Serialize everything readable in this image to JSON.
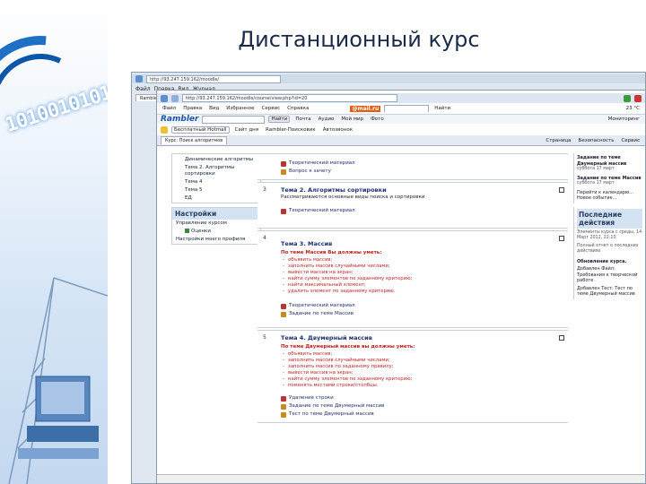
{
  "slide": {
    "title": "Дистанционный курс"
  },
  "decor": {
    "binary_text": "10100101010"
  },
  "back_window": {
    "address": "http://93.247.159.162/moodle/",
    "menu_items": [
      "Файл",
      "Правка",
      "Вид",
      "Журнал"
    ],
    "tab_labels": [
      "Rambler"
    ]
  },
  "browser": {
    "address": "http://93.247.159.162/moodle/course/view.php?id=20",
    "menu_items": [
      "Файл",
      "Правка",
      "Вид",
      "Избранное",
      "Сервис",
      "Справка"
    ],
    "toolbar": {
      "favorites": "Избранное",
      "rambler": "Rambler",
      "mail": "@mail.ru",
      "search_btn": "Найти",
      "search_btn2": "Найти",
      "items": [
        "Почта",
        "Аудио",
        "Мой мир",
        "Фото"
      ],
      "temp": "23 °C",
      "monitor": "Мониторинг"
    },
    "links_bar": [
      "Бесплатный Hotmail",
      "Сайт дня",
      "Rambler-Поисковик",
      "Автозвонок"
    ],
    "tab_label": "Курс: Поиск алгоритмов",
    "right_tools": [
      "Страница",
      "Безопасность",
      "Сервис"
    ]
  },
  "left_blocks": {
    "tree": [
      "Динамические алгоритмы",
      "Тема 2. Алгоритмы сортировки",
      "Тема 4",
      "Тема 5",
      "ЕД"
    ],
    "settings": {
      "title": "Настройки",
      "items": [
        "Управление курсом",
        "Оценки",
        "Настройки моего профиля"
      ]
    },
    "cut_letters": [
      "Н"
    ]
  },
  "topics": [
    {
      "num": "",
      "title": "",
      "subtitle": "",
      "must": "",
      "bullets": [],
      "resources": [
        "Теоретический материал",
        "Вопрос к зачету"
      ]
    },
    {
      "num": "3",
      "title": "Тема 2. Алгоритмы сортировки",
      "subtitle": "Рассматриваются основные виды поиска и сортировки",
      "must": "",
      "bullets": [],
      "resources": [
        "Теоретический материал"
      ]
    },
    {
      "num": "4",
      "title": "Тема 3. Массив",
      "subtitle": "",
      "must": "По теме Массив Вы должны уметь:",
      "bullets": [
        "объявить массив;",
        "заполнить массив случайными числами;",
        "вывести массив на экран;",
        "найти сумму элементов по заданному критерию;",
        "найти максимальный элемент;",
        "удалить элемент по заданному критерию."
      ],
      "resources": [
        "Теоретический материал",
        "Задание по теме Массив"
      ]
    },
    {
      "num": "5",
      "title": "Тема 4. Двумерный массив",
      "subtitle": "",
      "must": "По теме Двумерный массив вы должны уметь:",
      "bullets": [
        "объявить массив;",
        "заполнить массив случайными числами;",
        "заполнить массив по заданному правилу;",
        "вывести массив на экран;",
        "найти сумму элементов по заданному критерию;",
        "поменять местами строки/столбцы."
      ],
      "resources": [
        "Удаление строки",
        "Задание по теме Двумерный массив",
        "Тест по теме Двумерный массив"
      ]
    }
  ],
  "right_blocks": {
    "events": {
      "items": [
        {
          "title": "Задание по теме Двумерный массив",
          "date": "суббота 17 март"
        },
        {
          "title": "Задание по теме Массив",
          "date": "суббота 17 март"
        }
      ],
      "links": [
        "Перейти к календарю...",
        "Новое событие..."
      ]
    },
    "recent": {
      "title": "Последние действия",
      "since": "Элементы курса с среды, 14 Март 2012, 22:10",
      "report": "Полный отчет о последних действиях",
      "updates_title": "Обновление курса.",
      "updates": [
        "Добавлен Файл: Требования к творческой работе",
        "Добавлен Тест: Тест по теме Двумерный массив"
      ]
    }
  },
  "colors": {
    "accent": "#1a3070",
    "highlight": "#c02020",
    "block_header": "#d4e3f2"
  }
}
